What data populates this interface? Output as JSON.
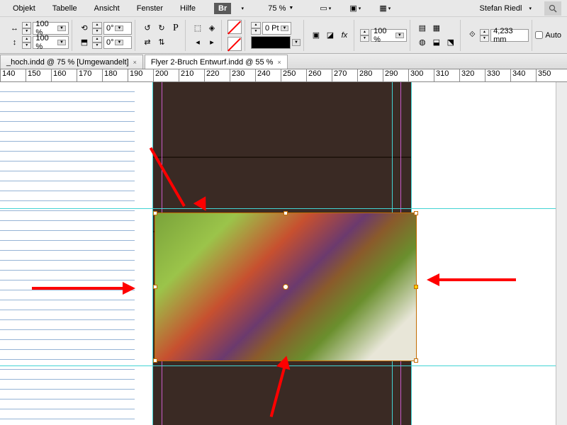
{
  "menu": {
    "objekt": "Objekt",
    "tabelle": "Tabelle",
    "ansicht": "Ansicht",
    "fenster": "Fenster",
    "hilfe": "Hilfe",
    "br": "Br",
    "zoom": "75 %",
    "user": "Stefan Riedl"
  },
  "ctrl": {
    "scale_x": "100 %",
    "scale_y": "100 %",
    "rot": "0°",
    "shear": "0°",
    "stroke_pt": "0 Pt",
    "opacity": "100 %",
    "xy": "4,233 mm",
    "auto": "Auto"
  },
  "tabs": {
    "t1": "_hoch.indd @ 75 % [Umgewandelt]",
    "t2": "Flyer 2-Bruch Entwurf.indd @ 55 %"
  },
  "ruler_ticks": [
    "140",
    "150",
    "160",
    "170",
    "180",
    "190",
    "200",
    "210",
    "220",
    "230",
    "240",
    "250",
    "260",
    "270",
    "280",
    "290",
    "300",
    "310",
    "320",
    "330",
    "340",
    "350"
  ]
}
